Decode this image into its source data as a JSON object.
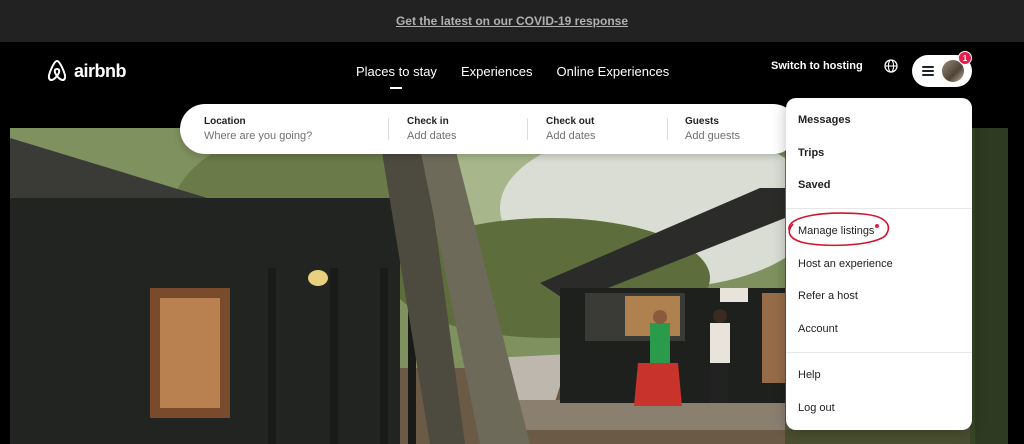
{
  "banner": {
    "text": "Get the latest on our COVID-19 response"
  },
  "nav": {
    "logo_text": "airbnb",
    "tabs": [
      {
        "label": "Places to stay",
        "active": true
      },
      {
        "label": "Experiences",
        "active": false
      },
      {
        "label": "Online Experiences",
        "active": false
      }
    ],
    "switch_hosting": "Switch to hosting",
    "notification_count": "1"
  },
  "search": {
    "location": {
      "label": "Location",
      "placeholder": "Where are you going?"
    },
    "check_in": {
      "label": "Check in",
      "placeholder": "Add dates"
    },
    "check_out": {
      "label": "Check out",
      "placeholder": "Add dates"
    },
    "guests": {
      "label": "Guests",
      "placeholder": "Add guests"
    }
  },
  "menu": {
    "items_primary": [
      "Messages",
      "Trips",
      "Saved"
    ],
    "manage_listings": "Manage listings",
    "host_experience": "Host an experience",
    "refer_host": "Refer a host",
    "account": "Account",
    "help": "Help",
    "logout": "Log out"
  },
  "colors": {
    "brand": "#e51d4d",
    "banner_bg": "#222222",
    "annotation": "#d0142c"
  }
}
